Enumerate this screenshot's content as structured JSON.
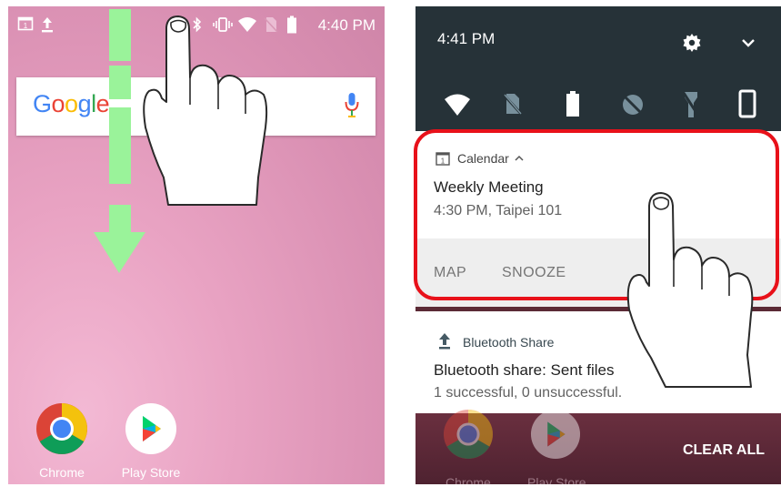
{
  "left_phone": {
    "status_bar": {
      "time": "4:40 PM",
      "calendar_badge": "1"
    },
    "search": {
      "logo": [
        "G",
        "o",
        "o",
        "g",
        "l",
        "e"
      ]
    },
    "dock": [
      {
        "label": "Chrome",
        "icon": "chrome-icon"
      },
      {
        "label": "Play Store",
        "icon": "play-store-icon"
      }
    ]
  },
  "right_phone": {
    "quick_settings": {
      "time": "4:41 PM",
      "tiles": [
        "wifi-icon",
        "no-sim-icon",
        "battery-icon",
        "data-saver-icon",
        "flashlight-off-icon",
        "rotate-icon"
      ]
    },
    "notification_calendar": {
      "app": "Calendar",
      "badge": "1",
      "title": "Weekly Meeting",
      "subtitle": "4:30 PM, Taipei 101",
      "actions": [
        "MAP",
        "SNOOZE"
      ]
    },
    "notification_bluetooth": {
      "app": "Bluetooth Share",
      "title": "Bluetooth share: Sent files",
      "subtitle": "1 successful, 0 unsuccessful."
    },
    "clear_all": "CLEAR ALL",
    "dimmed_dock": [
      "Chrome",
      "Play Store"
    ]
  },
  "colors": {
    "highlight": "#e8111a",
    "arrow": "#9af39a",
    "qs_background": "#263238"
  }
}
